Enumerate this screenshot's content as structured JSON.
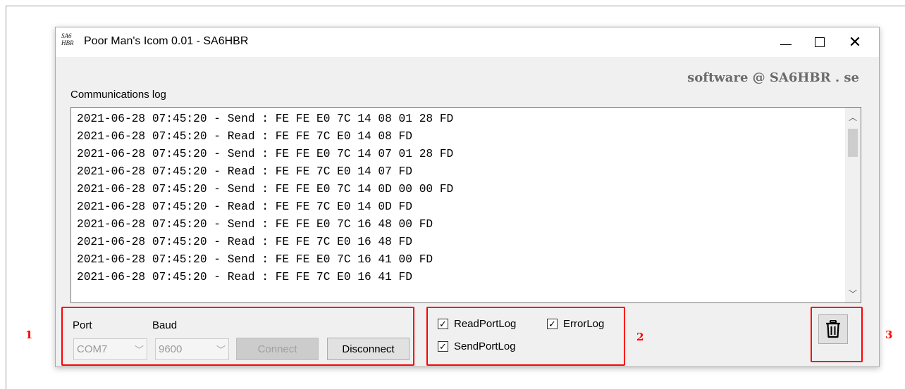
{
  "window": {
    "title": "Poor Man's Icom 0.01 - SA6HBR",
    "icon_text_line1": "SA6",
    "icon_text_line2": "HBR",
    "brand": "software @ SA6HBR . se"
  },
  "log": {
    "label": "Communications log",
    "lines": [
      "2021-06-28 07:45:20 - Send : FE FE E0 7C 14 08 01 28 FD",
      "2021-06-28 07:45:20 - Read : FE FE 7C E0 14 08 FD",
      "2021-06-28 07:45:20 - Send : FE FE E0 7C 14 07 01 28 FD",
      "2021-06-28 07:45:20 - Read : FE FE 7C E0 14 07 FD",
      "2021-06-28 07:45:20 - Send : FE FE E0 7C 14 0D 00 00 FD",
      "2021-06-28 07:45:20 - Read : FE FE 7C E0 14 0D FD",
      "2021-06-28 07:45:20 - Send : FE FE E0 7C 16 48 00 FD",
      "2021-06-28 07:45:20 - Read : FE FE 7C E0 16 48 FD",
      "2021-06-28 07:45:20 - Send : FE FE E0 7C 16 41 00 FD",
      "2021-06-28 07:45:20 - Read : FE FE 7C E0 16 41 FD"
    ]
  },
  "connection": {
    "port_label": "Port",
    "baud_label": "Baud",
    "port_value": "COM7",
    "baud_value": "9600",
    "connect_label": "Connect",
    "disconnect_label": "Disconnect"
  },
  "logging": {
    "read_port_log": "ReadPortLog",
    "error_log": "ErrorLog",
    "send_port_log": "SendPortLog",
    "check_mark": "✓"
  },
  "callouts": {
    "one": "1",
    "two": "2",
    "three": "3"
  },
  "colors": {
    "callout": "#ff0000",
    "window_bg": "#f0f0f0"
  },
  "icons": {
    "trash": "trash-icon",
    "close": "close-icon",
    "maximize": "maximize-icon",
    "minimize": "minimize-icon"
  }
}
